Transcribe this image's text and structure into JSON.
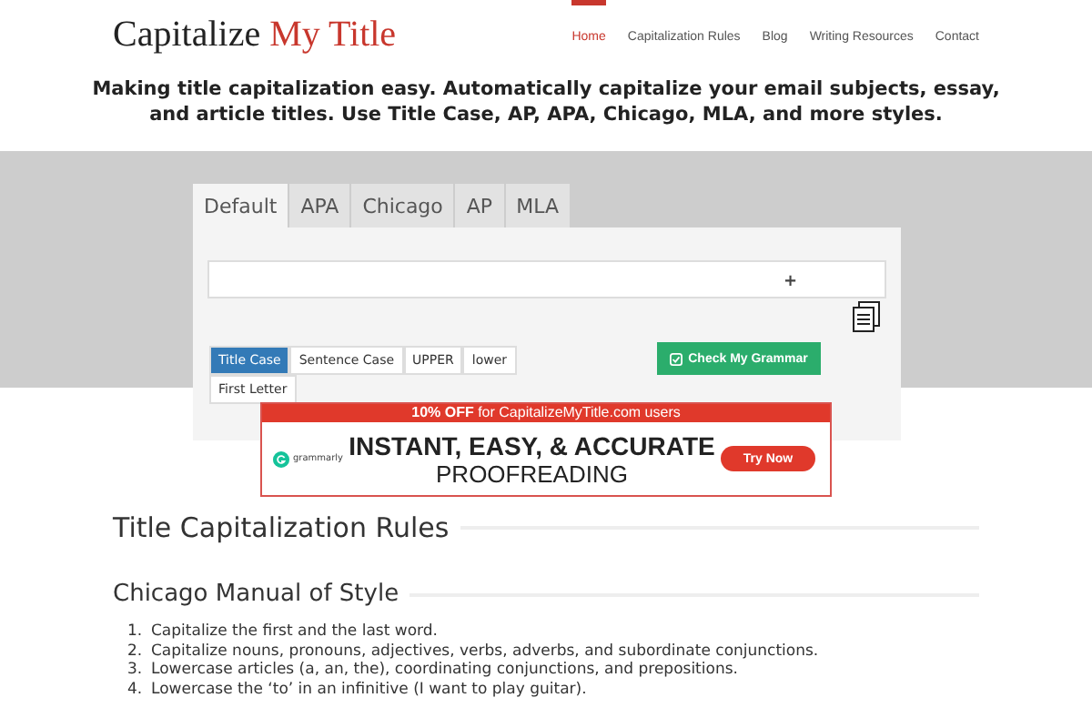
{
  "logo": {
    "first": "Capitalize",
    "second": "My Title"
  },
  "nav": [
    {
      "label": "Home",
      "selected": true
    },
    {
      "label": "Capitalization Rules",
      "selected": false
    },
    {
      "label": "Blog",
      "selected": false
    },
    {
      "label": "Writing Resources",
      "selected": false
    },
    {
      "label": "Contact",
      "selected": false
    }
  ],
  "tagline": "Making title capitalization easy. Automatically capitalize your email subjects, essay, and article titles. Use Title Case, AP, APA, Chicago, MLA, and more styles.",
  "tabs": [
    {
      "label": "Default",
      "selected": true
    },
    {
      "label": "APA",
      "selected": false
    },
    {
      "label": "Chicago",
      "selected": false
    },
    {
      "label": "AP",
      "selected": false
    },
    {
      "label": "MLA",
      "selected": false
    }
  ],
  "input": {
    "marker": "+"
  },
  "case_buttons": [
    {
      "label": "Title Case",
      "selected": true
    },
    {
      "label": "Sentence Case",
      "selected": false
    },
    {
      "label": "UPPER",
      "selected": false
    },
    {
      "label": "lower",
      "selected": false
    },
    {
      "label": "First Letter",
      "selected": false
    }
  ],
  "grammar_button": "Check My Grammar",
  "ad": {
    "banner": "**10% OFF** for CapitalizeMyTitle.com users",
    "brand": "grammarly",
    "headline": "INSTANT, EASY, & ACCURATE",
    "subline": "PROOFREADING",
    "cta": "Try Now"
  },
  "section_title": "Title Capitalization Rules",
  "subsection_title": "Chicago Manual of Style",
  "rules": [
    {
      "number": "1.",
      "text": "Capitalize the first and the last word."
    },
    {
      "number": "2.",
      "text": "Capitalize nouns, pronouns, adjectives, verbs, adverbs, and subordinate conjunctions."
    },
    {
      "number": "3.",
      "text": "Lowercase articles (a, an, the), coordinating conjunctions, and prepositions."
    },
    {
      "number": "4.",
      "text": "Lowercase the ‘to’ in an infinitive (I want to play guitar)."
    }
  ]
}
